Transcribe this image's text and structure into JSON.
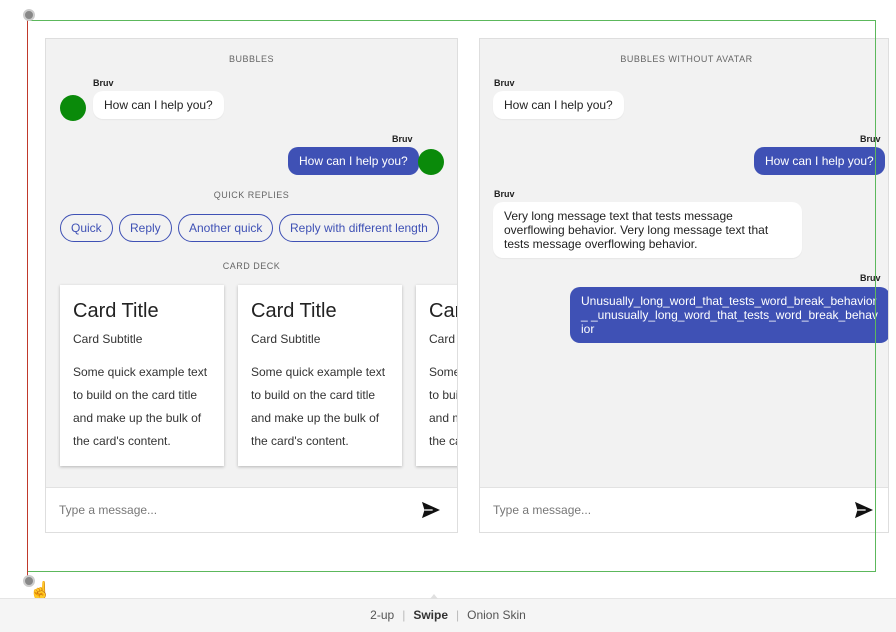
{
  "left_panel": {
    "bubbles_label": "BUBBLES",
    "messages": [
      {
        "sender": "Bruv",
        "text": "How can I help you?"
      },
      {
        "sender": "Bruv",
        "text": "How can I help you?"
      }
    ],
    "quick_replies_label": "QUICK REPLIES",
    "quick_replies": [
      "Quick",
      "Reply",
      "Another quick",
      "Reply with different length"
    ],
    "card_deck_label": "CARD DECK",
    "cards": [
      {
        "title": "Card Title",
        "subtitle": "Card Subtitle",
        "text": "Some quick example text to build on the card title and make up the bulk of the card's content."
      },
      {
        "title": "Card Title",
        "subtitle": "Card Subtitle",
        "text": "Some quick example text to build on the card title and make up the bulk of the card's content."
      },
      {
        "title": "Card Title",
        "subtitle": "Card Subtitle",
        "text": "Some quick example text to build on the card title and make up the bulk of the card's content."
      }
    ],
    "composer_placeholder": "Type a message..."
  },
  "right_panel": {
    "label": "BUBBLES WITHOUT AVATAR",
    "messages": [
      {
        "sender": "Bruv",
        "text": "How can I help you?"
      },
      {
        "sender": "Bruv",
        "text": "How can I help you?"
      },
      {
        "sender": "Bruv",
        "text": "Very long message text that tests message overflowing behavior. Very long message text that tests message overflowing behavior."
      },
      {
        "sender": "Bruv",
        "text": "Unusually_long_word_that_tests_word_break_behavior_ _unusually_long_word_that_tests_word_break_behavior"
      }
    ],
    "composer_placeholder": "Type a message..."
  },
  "view_modes": {
    "two_up": "2-up",
    "swipe": "Swipe",
    "onion_skin": "Onion Skin",
    "active": "Swipe"
  },
  "colors": {
    "outgoing_bubble": "#3f51b5",
    "avatar": "#0a8a0a",
    "frame_border": "#5cb85c",
    "swipe_line": "#c0392b"
  }
}
